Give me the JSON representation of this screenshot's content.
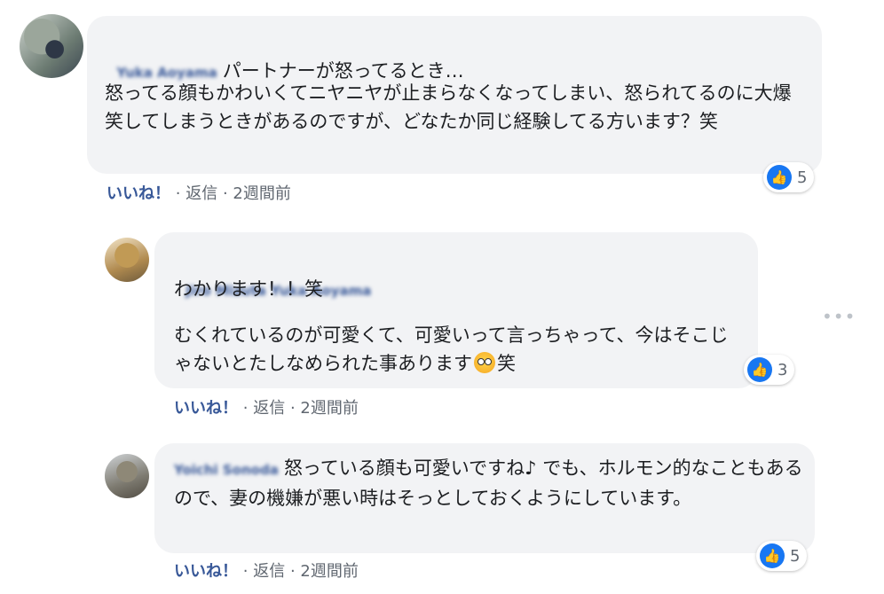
{
  "comments": [
    {
      "author": "Yuka Aoyama",
      "header_text": "パートナーが怒ってるとき…",
      "body": "怒ってる顔もかわいくてニヤニヤが止まらなくなってしまい、怒られてるのに大爆笑してしまうときがあるのですが、どなたか同じ経験してる方います？笑",
      "like_label": "いいね！",
      "reply_label": "返信",
      "time": "2週間前",
      "reactions": "5"
    },
    {
      "author": "Jiro Mizuta Yuka Aoyama",
      "line1": "わかります！！笑",
      "body_before_emoji": "むくれているのが可愛くて、可愛いって言っちゃって、今はそこじゃないとたしなめられた事あります",
      "body_after_emoji": "笑",
      "like_label": "いいね！",
      "reply_label": "返信",
      "time": "2週間前",
      "reactions": "3"
    },
    {
      "author": "Yoichi Sonoda",
      "body": "怒っている顔も可愛いですね♪ でも、ホルモン的なこともあるので、妻の機嫌が悪い時はそっとしておくようにしています。",
      "like_label": "いいね！",
      "reply_label": "返信",
      "time": "2週間前",
      "reactions": "5"
    }
  ],
  "sep": "·",
  "more_icon": "more-icon"
}
